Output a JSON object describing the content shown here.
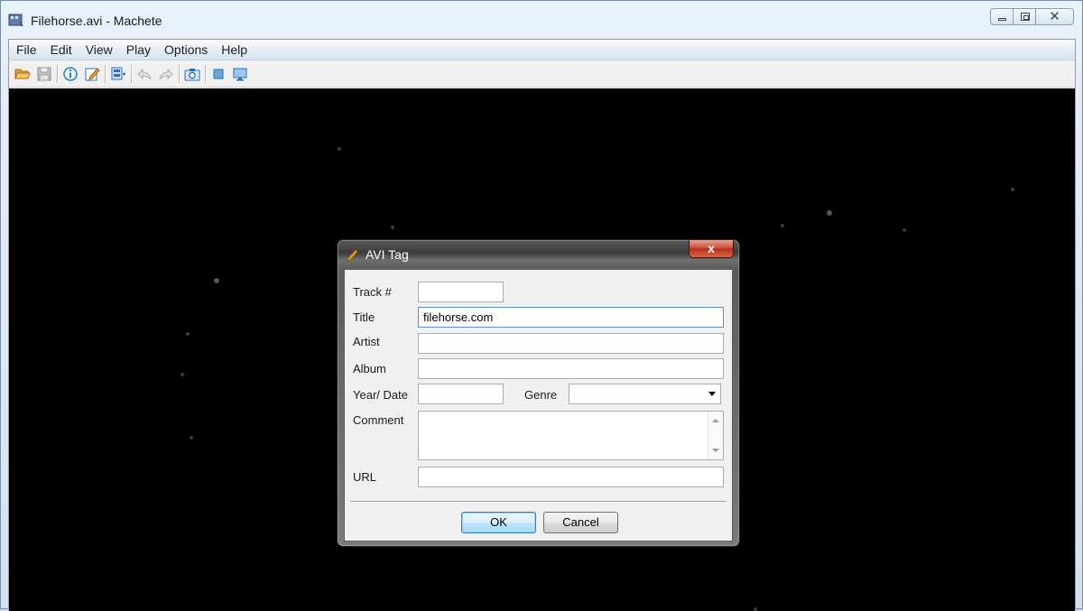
{
  "window": {
    "title": "Filehorse.avi - Machete"
  },
  "menu": {
    "items": [
      "File",
      "Edit",
      "View",
      "Play",
      "Options",
      "Help"
    ]
  },
  "toolbar": {
    "icons": [
      "open-folder-icon",
      "save-icon",
      "info-icon",
      "edit-tag-icon",
      "video-frames-icon",
      "undo-icon",
      "redo-icon",
      "snapshot-camera-icon",
      "stop-square-icon",
      "monitor-icon"
    ]
  },
  "dialog": {
    "title": "AVI Tag",
    "close_label": "x",
    "fields": {
      "track": {
        "label": "Track #",
        "value": ""
      },
      "title": {
        "label": "Title",
        "value": "filehorse.com"
      },
      "artist": {
        "label": "Artist",
        "value": ""
      },
      "album": {
        "label": "Album",
        "value": ""
      },
      "year": {
        "label": "Year/ Date",
        "value": ""
      },
      "genre": {
        "label": "Genre",
        "value": ""
      },
      "comment": {
        "label": "Comment",
        "value": ""
      },
      "url": {
        "label": "URL",
        "value": ""
      }
    },
    "ok_label": "OK",
    "cancel_label": "Cancel"
  }
}
